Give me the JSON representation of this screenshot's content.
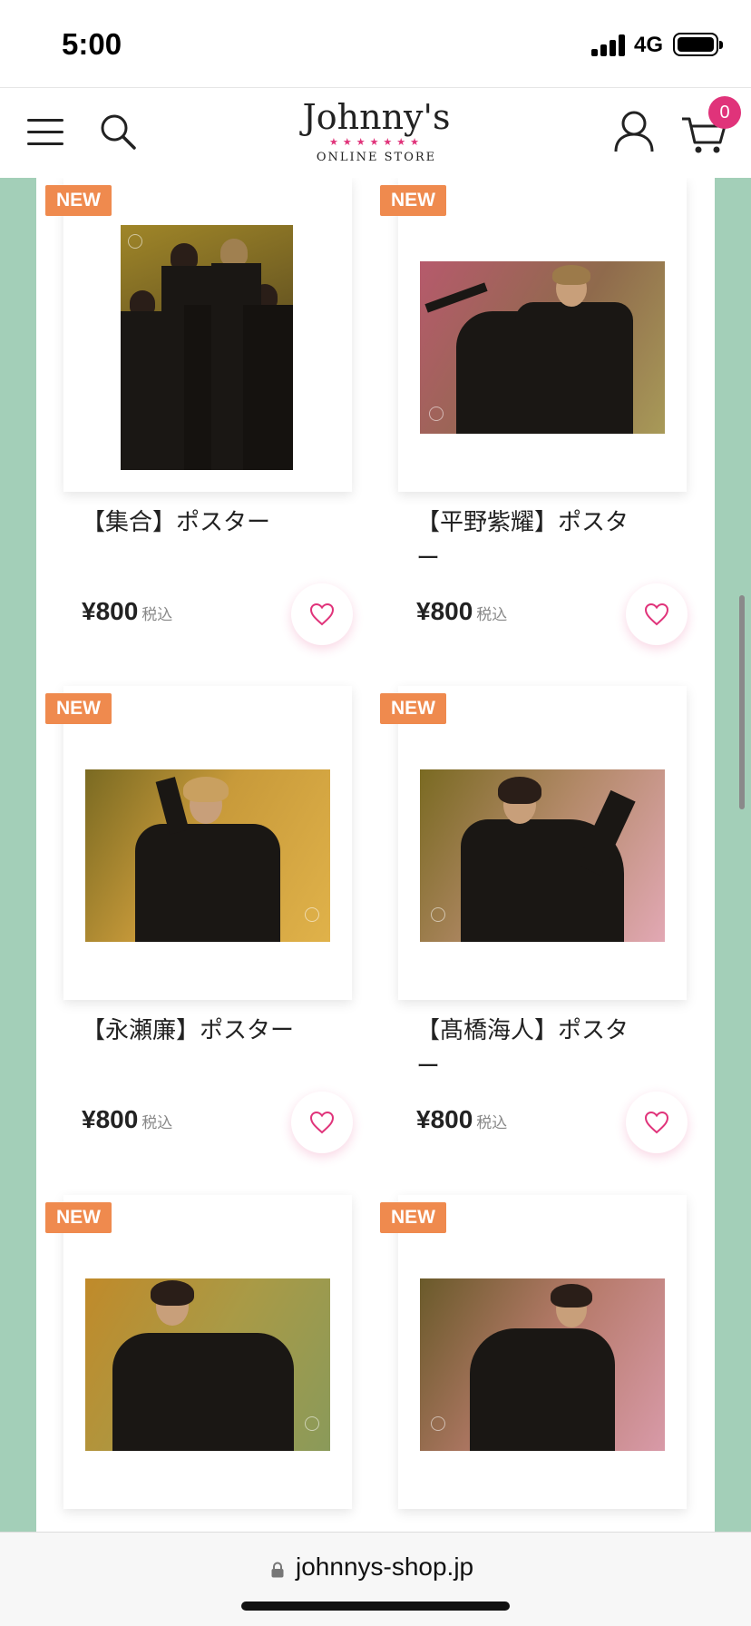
{
  "status_bar": {
    "time": "5:00",
    "network": "4G",
    "signal_icon": "signal-icon",
    "battery_icon": "battery-icon"
  },
  "header": {
    "logo_text": "Johnny's",
    "logo_stars": "★★★★★★★",
    "logo_subtitle": "ONLINE STORE",
    "cart_count": "0",
    "icons": [
      "hamburger-menu-icon",
      "search-icon",
      "account-icon",
      "cart-icon"
    ]
  },
  "products": [
    {
      "badge": "NEW",
      "name": "【集合】ポスター",
      "price": "¥800",
      "tax_label": "税込"
    },
    {
      "badge": "NEW",
      "name": "【平野紫耀】ポスター",
      "price": "¥800",
      "tax_label": "税込"
    },
    {
      "badge": "NEW",
      "name": "【永瀬廉】ポスター",
      "price": "¥800",
      "tax_label": "税込"
    },
    {
      "badge": "NEW",
      "name": "【髙橋海人】ポスター",
      "price": "¥800",
      "tax_label": "税込"
    },
    {
      "badge": "NEW",
      "name": "",
      "price": "",
      "tax_label": ""
    },
    {
      "badge": "NEW",
      "name": "",
      "price": "",
      "tax_label": ""
    }
  ],
  "address_bar": {
    "url": "johnnys-shop.jp"
  },
  "colors": {
    "accent_pink": "#e0337a",
    "badge_orange": "#ef8a4e",
    "side_green": "#a3cfb8"
  }
}
